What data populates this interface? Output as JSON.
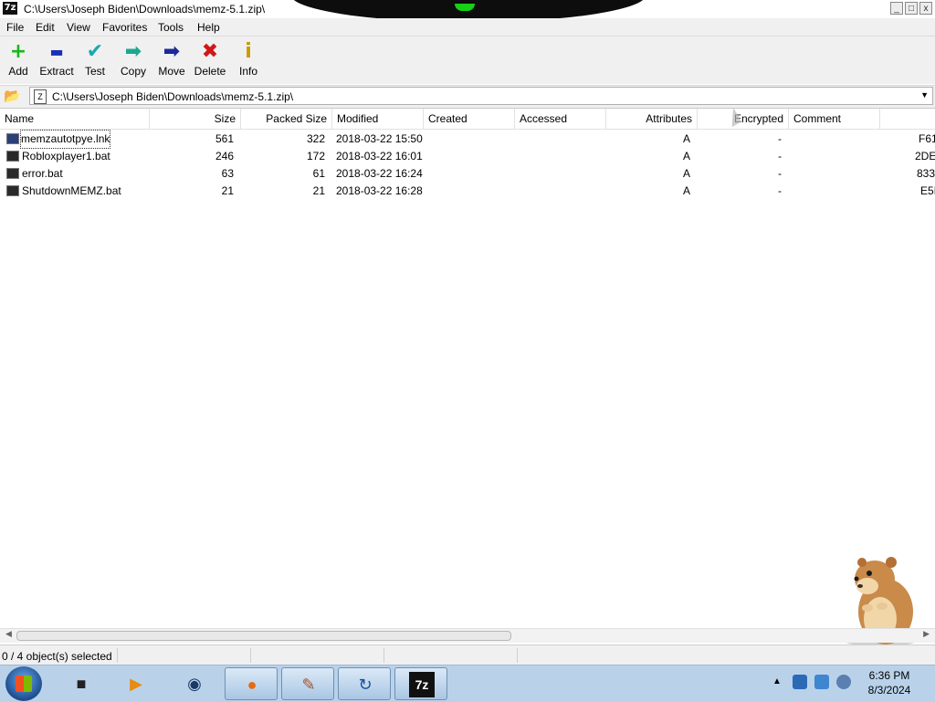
{
  "window": {
    "title": "C:\\Users\\Joseph Biden\\Downloads\\memz-5.1.zip\\",
    "app_icon": "7z",
    "controls": {
      "minimize": "_",
      "maximize": "□",
      "close": "x"
    }
  },
  "menu": {
    "items": [
      "File",
      "Edit",
      "View",
      "Favorites",
      "Tools",
      "Help"
    ]
  },
  "toolbar": {
    "buttons": [
      {
        "label": "Add",
        "icon": "plus-icon",
        "glyph": "+",
        "color": "#1db31d"
      },
      {
        "label": "Extract",
        "icon": "minus-icon",
        "glyph": "▬",
        "color": "#1a2fb8"
      },
      {
        "label": "Test",
        "icon": "check-icon",
        "glyph": "✔",
        "color": "#1aa8b0"
      },
      {
        "label": "Copy",
        "icon": "copy-arrow-icon",
        "glyph": "➡",
        "color": "#1aa890"
      },
      {
        "label": "Move",
        "icon": "move-arrow-icon",
        "glyph": "➡",
        "color": "#1a2a9a"
      },
      {
        "label": "Delete",
        "icon": "delete-x-icon",
        "glyph": "✖",
        "color": "#d01818"
      },
      {
        "label": "Info",
        "icon": "info-icon",
        "glyph": "i",
        "color": "#c89a00"
      }
    ]
  },
  "address": {
    "path": "C:\\Users\\Joseph Biden\\Downloads\\memz-5.1.zip\\",
    "dropdown": "▼"
  },
  "columns": [
    "Name",
    "Size",
    "Packed Size",
    "Modified",
    "Created",
    "Accessed",
    "Attributes",
    "Encrypted",
    "Comment"
  ],
  "files": [
    {
      "name": "memzautotpye.lnk",
      "size": "561",
      "packed": "322",
      "modified": "2018-03-22 15:50",
      "attributes": "A",
      "encrypted": "-",
      "crc": "F61"
    },
    {
      "name": "Robloxplayer1.bat",
      "size": "246",
      "packed": "172",
      "modified": "2018-03-22 16:01",
      "attributes": "A",
      "encrypted": "-",
      "crc": "2DE"
    },
    {
      "name": "error.bat",
      "size": "63",
      "packed": "61",
      "modified": "2018-03-22 16:24",
      "attributes": "A",
      "encrypted": "-",
      "crc": "833"
    },
    {
      "name": "ShutdownMEMZ.bat",
      "size": "21",
      "packed": "21",
      "modified": "2018-03-22 16:28",
      "attributes": "A",
      "encrypted": "-",
      "crc": "E5I"
    }
  ],
  "status": {
    "text": "0 / 4 object(s) selected"
  },
  "taskbar": {
    "buttons": [
      {
        "icon": "terminal-icon",
        "glyph": "■"
      },
      {
        "icon": "media-player-icon",
        "glyph": "▶"
      },
      {
        "icon": "globe-icon",
        "glyph": "◉"
      },
      {
        "icon": "firefox-icon",
        "glyph": "●"
      },
      {
        "icon": "paint-icon",
        "glyph": "✎"
      },
      {
        "icon": "app-arrow-icon",
        "glyph": "↻"
      },
      {
        "icon": "seven-zip-icon",
        "glyph": "7z"
      }
    ],
    "tray_arrow": "▲",
    "clock": {
      "time": "6:36 PM",
      "date": "8/3/2024"
    }
  },
  "colors": {
    "taskbar": "#b9d2ea",
    "window_bg": "#f0f0f0",
    "hamster_fur": "#c98a4a"
  }
}
